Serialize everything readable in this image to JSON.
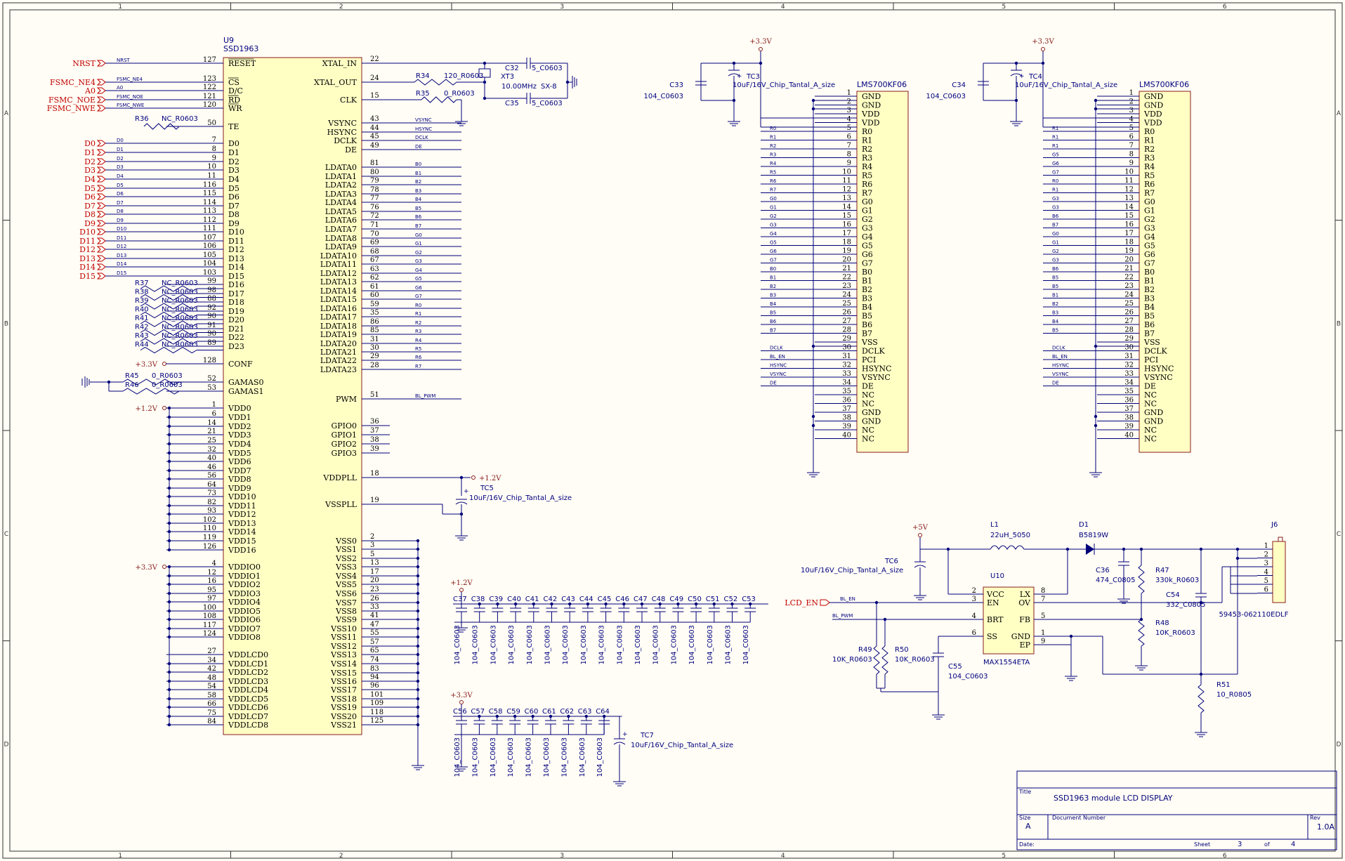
{
  "colors": {
    "wire": "#00007a",
    "body": "#ffffc4",
    "border": "#8a1c1c",
    "net": "#c00000",
    "text": "#000080"
  },
  "frame": {
    "cols": [
      "1",
      "2",
      "3",
      "4",
      "5",
      "6"
    ],
    "rows": [
      "A",
      "B",
      "C",
      "D"
    ]
  },
  "u9": {
    "ref": "U9",
    "part": "SSD1963",
    "left_pins": [
      [
        "127",
        "RESET",
        "NRST"
      ],
      [
        "123",
        "CS",
        "FSMC_NE4"
      ],
      [
        "122",
        "D/C",
        "A0"
      ],
      [
        "121",
        "RD",
        "FSMC_NOE"
      ],
      [
        "120",
        "WR",
        "FSMC_NWE"
      ],
      [
        "50",
        "TE",
        ""
      ],
      [
        "7",
        "D0",
        "D0"
      ],
      [
        "8",
        "D1",
        "D1"
      ],
      [
        "9",
        "D2",
        "D2"
      ],
      [
        "10",
        "D3",
        "D3"
      ],
      [
        "11",
        "D4",
        "D4"
      ],
      [
        "116",
        "D5",
        "D5"
      ],
      [
        "115",
        "D6",
        "D6"
      ],
      [
        "114",
        "D7",
        "D7"
      ],
      [
        "113",
        "D8",
        "D8"
      ],
      [
        "112",
        "D9",
        "D9"
      ],
      [
        "111",
        "D10",
        "D10"
      ],
      [
        "107",
        "D11",
        "D11"
      ],
      [
        "106",
        "D12",
        "D12"
      ],
      [
        "105",
        "D13",
        "D13"
      ],
      [
        "104",
        "D14",
        "D14"
      ],
      [
        "103",
        "D15",
        "D15"
      ],
      [
        "99",
        "D16",
        ""
      ],
      [
        "98",
        "D17",
        ""
      ],
      [
        "88",
        "D18",
        ""
      ],
      [
        "92",
        "D19",
        ""
      ],
      [
        "90",
        "D20",
        ""
      ],
      [
        "91",
        "D21",
        ""
      ],
      [
        "90",
        "D22",
        ""
      ],
      [
        "89",
        "D23",
        ""
      ],
      [
        "128",
        "CONF",
        ""
      ],
      [
        "52",
        "GAMAS0",
        ""
      ],
      [
        "53",
        "GAMAS1",
        ""
      ],
      [
        "1",
        "VDD0",
        ""
      ],
      [
        "6",
        "VDD1",
        ""
      ],
      [
        "14",
        "VDD2",
        ""
      ],
      [
        "21",
        "VDD3",
        ""
      ],
      [
        "25",
        "VDD4",
        ""
      ],
      [
        "32",
        "VDD5",
        ""
      ],
      [
        "40",
        "VDD6",
        ""
      ],
      [
        "46",
        "VDD7",
        ""
      ],
      [
        "56",
        "VDD8",
        ""
      ],
      [
        "64",
        "VDD9",
        ""
      ],
      [
        "73",
        "VDD10",
        ""
      ],
      [
        "82",
        "VDD11",
        ""
      ],
      [
        "93",
        "VDD12",
        ""
      ],
      [
        "102",
        "VDD13",
        ""
      ],
      [
        "110",
        "VDD14",
        ""
      ],
      [
        "119",
        "VDD15",
        ""
      ],
      [
        "126",
        "VDD16",
        ""
      ],
      [
        "4",
        "VDDIO0",
        ""
      ],
      [
        "12",
        "VDDIO1",
        ""
      ],
      [
        "16",
        "VDDIO2",
        ""
      ],
      [
        "95",
        "VDDIO3",
        ""
      ],
      [
        "97",
        "VDDIO4",
        ""
      ],
      [
        "100",
        "VDDIO5",
        ""
      ],
      [
        "108",
        "VDDIO6",
        ""
      ],
      [
        "117",
        "VDDIO7",
        ""
      ],
      [
        "124",
        "VDDIO8",
        ""
      ],
      [
        "27",
        "VDDLCD0",
        ""
      ],
      [
        "34",
        "VDDLCD1",
        ""
      ],
      [
        "42",
        "VDDLCD2",
        ""
      ],
      [
        "48",
        "VDDLCD3",
        ""
      ],
      [
        "54",
        "VDDLCD4",
        ""
      ],
      [
        "58",
        "VDDLCD5",
        ""
      ],
      [
        "66",
        "VDDLCD6",
        ""
      ],
      [
        "75",
        "VDDLCD7",
        ""
      ],
      [
        "84",
        "VDDLCD8",
        ""
      ]
    ],
    "right_pins": [
      [
        "22",
        "XTAL_IN",
        ""
      ],
      [
        "24",
        "XTAL_OUT",
        ""
      ],
      [
        "15",
        "CLK",
        ""
      ],
      [
        "43",
        "VSYNC",
        "VSYNC"
      ],
      [
        "44",
        "HSYNC",
        "HSYNC"
      ],
      [
        "45",
        "DCLK",
        "DCLK"
      ],
      [
        "49",
        "DE",
        "DE"
      ],
      [
        "81",
        "LDATA0",
        "B0"
      ],
      [
        "80",
        "LDATA1",
        "B1"
      ],
      [
        "79",
        "LDATA2",
        "B2"
      ],
      [
        "78",
        "LDATA3",
        "B3"
      ],
      [
        "77",
        "LDATA4",
        "B4"
      ],
      [
        "76",
        "LDATA5",
        "B5"
      ],
      [
        "72",
        "LDATA6",
        "B6"
      ],
      [
        "71",
        "LDATA7",
        "B7"
      ],
      [
        "70",
        "LDATA8",
        "G0"
      ],
      [
        "69",
        "LDATA9",
        "G1"
      ],
      [
        "68",
        "LDATA10",
        "G2"
      ],
      [
        "67",
        "LDATA11",
        "G3"
      ],
      [
        "63",
        "LDATA12",
        "G4"
      ],
      [
        "62",
        "LDATA13",
        "G5"
      ],
      [
        "61",
        "LDATA14",
        "G6"
      ],
      [
        "60",
        "LDATA15",
        "G7"
      ],
      [
        "59",
        "LDATA16",
        "R0"
      ],
      [
        "35",
        "LDATA17",
        "R1"
      ],
      [
        "86",
        "LDATA18",
        "R2"
      ],
      [
        "85",
        "LDATA19",
        "R3"
      ],
      [
        "31",
        "LDATA20",
        "R4"
      ],
      [
        "30",
        "LDATA21",
        "R5"
      ],
      [
        "29",
        "LDATA22",
        "R6"
      ],
      [
        "28",
        "LDATA23",
        "R7"
      ],
      [
        "51",
        "PWM",
        "BL_PWM"
      ],
      [
        "36",
        "GPIO0",
        ""
      ],
      [
        "37",
        "GPIO1",
        ""
      ],
      [
        "38",
        "GPIO2",
        ""
      ],
      [
        "39",
        "GPIO3",
        ""
      ],
      [
        "18",
        "VDDPLL",
        ""
      ],
      [
        "19",
        "VSSPLL",
        ""
      ],
      [
        "2",
        "VSS0",
        ""
      ],
      [
        "3",
        "VSS1",
        ""
      ],
      [
        "5",
        "VSS2",
        ""
      ],
      [
        "13",
        "VSS3",
        ""
      ],
      [
        "17",
        "VSS4",
        ""
      ],
      [
        "20",
        "VSS5",
        ""
      ],
      [
        "23",
        "VSS6",
        ""
      ],
      [
        "26",
        "VSS7",
        ""
      ],
      [
        "33",
        "VSS8",
        ""
      ],
      [
        "41",
        "VSS9",
        ""
      ],
      [
        "47",
        "VSS10",
        ""
      ],
      [
        "55",
        "VSS11",
        ""
      ],
      [
        "57",
        "VSS12",
        ""
      ],
      [
        "65",
        "VSS13",
        ""
      ],
      [
        "74",
        "VSS14",
        ""
      ],
      [
        "83",
        "VSS15",
        ""
      ],
      [
        "94",
        "VSS16",
        ""
      ],
      [
        "96",
        "VSS17",
        ""
      ],
      [
        "101",
        "VSS18",
        ""
      ],
      [
        "109",
        "VSS19",
        ""
      ],
      [
        "118",
        "VSS20",
        ""
      ],
      [
        "125",
        "VSS21",
        ""
      ]
    ]
  },
  "lcd1": {
    "part": "LMS700KF06",
    "nets": [
      "",
      "",
      "",
      "",
      "R0",
      "R1",
      "R2",
      "R3",
      "R4",
      "R5",
      "R6",
      "R7",
      "G0",
      "G1",
      "G2",
      "G3",
      "G4",
      "G5",
      "G6",
      "G7",
      "B0",
      "B1",
      "B2",
      "B3",
      "B4",
      "B5",
      "B6",
      "B7",
      "",
      "DCLK",
      "BL_EN",
      "HSYNC",
      "VSYNC",
      "DE",
      "",
      "",
      "",
      "",
      "",
      ""
    ]
  },
  "lcd2": {
    "part": "LMS700KF06",
    "nets": [
      "",
      "",
      "",
      "",
      "R1",
      "R1",
      "R1",
      "G5",
      "G6",
      "G7",
      "R0",
      "R1",
      "G3",
      "G3",
      "B6",
      "B7",
      "G0",
      "G1",
      "G2",
      "G3",
      "B6",
      "B5",
      "B5",
      "B1",
      "B2",
      "B3",
      "B4",
      "B5",
      "",
      "DCLK",
      "BL_EN",
      "HSYNC",
      "VSYNC",
      "DE",
      "",
      "",
      "",
      "",
      "",
      ""
    ]
  },
  "lcd_pins": [
    "GND",
    "GND",
    "VDD",
    "VDD",
    "R0",
    "R1",
    "R2",
    "R3",
    "R4",
    "R5",
    "R6",
    "R7",
    "G0",
    "G1",
    "G2",
    "G3",
    "G4",
    "G5",
    "G6",
    "G7",
    "B0",
    "B1",
    "B2",
    "B3",
    "B4",
    "B5",
    "B6",
    "B7",
    "VSS",
    "DCLK",
    "PCI",
    "HSYNC",
    "VSYNC",
    "DE",
    "NC",
    "NC",
    "GND",
    "GND",
    "NC",
    "NC"
  ],
  "labels": {
    "r34": "R34",
    "r34v": "120_R0603",
    "r35": "R35",
    "r35v": "0_R0603",
    "c32": "C32",
    "c32v": "5_C0603",
    "c35": "C35",
    "c35v": "5_C0603",
    "xt3": "XT3",
    "xt3v": "10.00MHz",
    "xt3p": "SX-8",
    "r36": "R36",
    "r36v": "NC_R0603",
    "r37": "R37",
    "r38": "R38",
    "r39": "R39",
    "r40": "R40",
    "r41": "R41",
    "r42": "R42",
    "r43": "R43",
    "r44": "R44",
    "ncr": "NC_R0603",
    "r45": "R45",
    "r45v": "0_R0603",
    "r46": "R46",
    "r46v": "0_R0603",
    "p33": "+3.3V",
    "p12": "+1.2V",
    "p5": "+5V",
    "tc5": "TC5",
    "tcv": "10uF/16V_Chip_Tantal_A_size",
    "c33": "C33",
    "c34": "C34",
    "c0603": "104_C0603",
    "tc3": "TC3",
    "tc4": "TC4",
    "tc6": "TC6",
    "tc7": "TC7",
    "l1": "L1",
    "l1v": "22uH_5050",
    "d1": "D1",
    "d1v": "B5819W",
    "j6": "J6",
    "j6v": "59453-062110EDLF",
    "c36": "C36",
    "c36v": "474_C0805",
    "r47": "R47",
    "r47v": "330k_R0603",
    "c54": "C54",
    "c54v": "332_C0805",
    "r48": "R48",
    "r48v": "10K_R0603",
    "u10": "U10",
    "u10p": "MAX1554ETA",
    "lcd_en": "LCD_EN",
    "bl_en": "BL_EN",
    "bl_pwm": "BL_PWM",
    "r49": "R49",
    "r49v": "10K_R0603",
    "r50": "R50",
    "r50v": "10K_R0603",
    "c55": "C55",
    "c55v": "104_C0603",
    "r51": "R51",
    "r51v": "10_R0805",
    "u10l": [
      "VCC",
      "EN",
      "BRT",
      "SS"
    ],
    "u10ln": [
      "2",
      "3",
      "4",
      "6"
    ],
    "u10r": [
      "LX",
      "OV",
      "FB",
      "GND",
      "EP"
    ],
    "u10rn": [
      "8",
      "7",
      "5",
      "1",
      "9"
    ],
    "capsA": [
      "C37",
      "C38",
      "C39",
      "C40",
      "C41",
      "C42",
      "C43",
      "C44",
      "C45",
      "C46",
      "C47",
      "C48",
      "C49",
      "C50",
      "C51",
      "C52",
      "C53"
    ],
    "capsB": [
      "C56",
      "C57",
      "C58",
      "C59",
      "C60",
      "C61",
      "C62",
      "C63",
      "C64"
    ]
  },
  "title_block": {
    "title_label": "Title",
    "title": "SSD1963 module  LCD DISPLAY",
    "size_label": "Size",
    "size": "A",
    "doc_label": "Document Number",
    "rev_label": "Rev",
    "rev": "1.0A",
    "date_label": "Date:",
    "sheet_label": "Sheet",
    "sheet": "3",
    "of_label": "of",
    "of": "4"
  }
}
